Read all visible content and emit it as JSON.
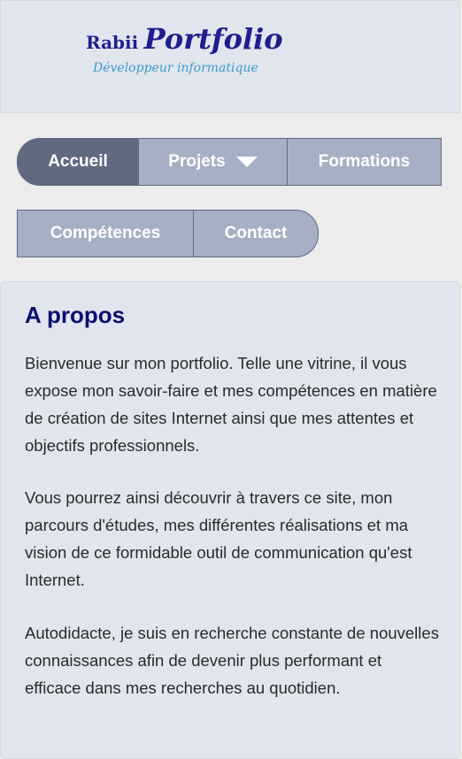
{
  "header": {
    "logo_name": "Rabii",
    "logo_title": "Portfolio",
    "logo_subtitle": "Développeur informatique"
  },
  "nav": {
    "row1": [
      {
        "label": "Accueil",
        "active": true
      },
      {
        "label": "Projets",
        "dropdown": true,
        "icon": "caret-down-icon"
      },
      {
        "label": "Formations"
      }
    ],
    "row2": [
      {
        "label": "Compétences"
      },
      {
        "label": "Contact"
      }
    ]
  },
  "about": {
    "title": "A propos",
    "paragraphs": [
      "Bienvenue sur mon portfolio. Telle une vitrine, il vous expose mon savoir-faire et mes compétences en matière de création de sites Internet ainsi que mes attentes et objectifs professionnels.",
      "Vous pourrez ainsi découvrir à travers ce site, mon parcours d'études, mes différentes réalisations et ma vision de ce formidable outil de communication qu'est Internet.",
      "Autodidacte, je suis en recherche constante de nouvelles connaissances afin de devenir plus performant et efficace dans mes recherches au quotidien."
    ]
  },
  "colors": {
    "nav_active": "#5f6a7e",
    "nav_bg": "#a6b0c4",
    "title": "#0b0f6e",
    "logo": "#1e1f8c",
    "subtitle": "#3a9bc9"
  }
}
